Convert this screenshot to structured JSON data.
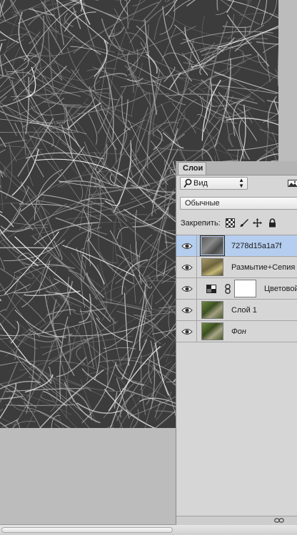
{
  "panel": {
    "tab_label": "Слои",
    "filter": {
      "label": "Вид",
      "icon": "search-icon"
    },
    "blend_mode": "Обычные",
    "lock_label": "Закрепить:",
    "lock_icons": [
      "lock-transparent-pixels-icon",
      "lock-image-pixels-icon",
      "lock-position-icon",
      "lock-all-icon"
    ]
  },
  "layers": [
    {
      "name": "7278d15a1a7f",
      "visible": true,
      "selected": true,
      "italic": false
    },
    {
      "name": "Размытие+Сепия",
      "visible": true,
      "selected": false,
      "italic": false
    },
    {
      "name": "Цветовой",
      "visible": true,
      "selected": false,
      "italic": false,
      "type": "adjustment"
    },
    {
      "name": "Слой 1",
      "visible": true,
      "selected": false,
      "italic": false
    },
    {
      "name": "Фон",
      "visible": true,
      "selected": false,
      "italic": true
    }
  ],
  "colors": {
    "selection": "#b5cdee",
    "panel_bg": "#d6d6d6",
    "canvas_bg": "#bcbcbc"
  }
}
